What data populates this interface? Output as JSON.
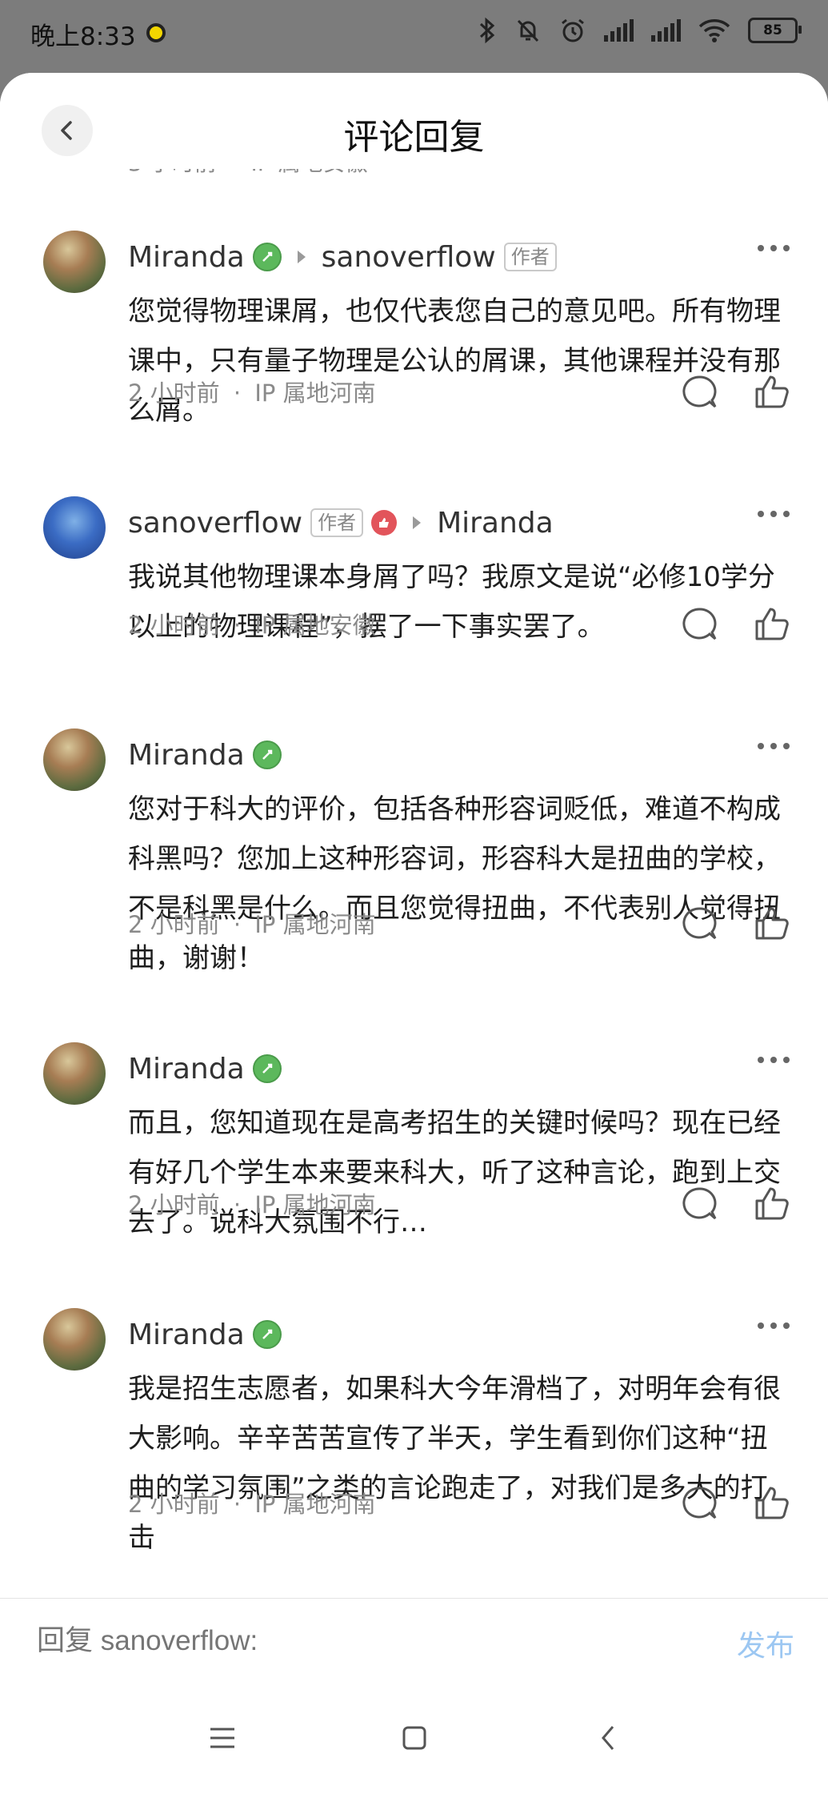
{
  "status_bar": {
    "time": "晚上8:33",
    "battery": "85"
  },
  "header": {
    "title": "评论回复"
  },
  "partial_previous": {
    "time": "3 小时前",
    "ip": "IP 属地安徽"
  },
  "comments": [
    {
      "author": "Miranda",
      "reply_to": "sanoverflow",
      "reply_to_tag": "作者",
      "text": "您觉得物理课屑，也仅代表您自己的意见吧。所有物理课中，只有量子物理是公认的屑课，其他课程并没有那么屑。",
      "time": "2 小时前",
      "ip": "IP 属地河南"
    },
    {
      "author": "sanoverflow",
      "author_tag": "作者",
      "reply_to": "Miranda",
      "text": "我说其他物理课本身屑了吗？我原文是说“必修10学分以上的物理课程”，摆了一下事实罢了。",
      "time": "2 小时前",
      "ip": "IP 属地安徽"
    },
    {
      "author": "Miranda",
      "text": "您对于科大的评价，包括各种形容词贬低，难道不构成科黑吗？您加上这种形容词，形容科大是扭曲的学校，不是科黑是什么。而且您觉得扭曲，不代表别人觉得扭曲，谢谢！",
      "time": "2 小时前",
      "ip": "IP 属地河南"
    },
    {
      "author": "Miranda",
      "text": "而且，您知道现在是高考招生的关键时候吗？现在已经有好几个学生本来要来科大，听了这种言论，跑到上交去了。说科大氛围不行…",
      "time": "2 小时前",
      "ip": "IP 属地河南"
    },
    {
      "author": "Miranda",
      "text": "我是招生志愿者，如果科大今年滑档了，对明年会有很大影响。辛辛苦苦宣传了半天，学生看到你们这种“扭曲的学习氛围”之类的言论跑走了，对我们是多大的打击",
      "time": "2 小时前",
      "ip": "IP 属地河南"
    }
  ],
  "separator": "·",
  "reply_bar": {
    "placeholder": "回复 sanoverflow:",
    "publish_label": "发布"
  },
  "colors": {
    "accent_publish": "#9cc7f2",
    "badge_green": "#5cb85c",
    "badge_red": "#e2545b",
    "meta_text": "#8a8a8a"
  },
  "icons": [
    "back-icon",
    "comment-icon",
    "like-icon",
    "more-icon",
    "verified-badge-icon",
    "thumb-badge-icon",
    "menu-icon",
    "home-icon",
    "nav-back-icon"
  ]
}
